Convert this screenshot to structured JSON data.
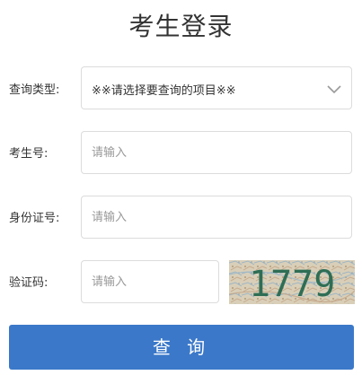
{
  "page": {
    "title": "考生登录"
  },
  "form": {
    "query_type": {
      "label": "查询类型:",
      "value": "※※请选择要查询的项目※※"
    },
    "exam_number": {
      "label": "考生号:",
      "placeholder": "请输入"
    },
    "id_number": {
      "label": "身份证号:",
      "placeholder": "请输入"
    },
    "captcha": {
      "label": "验证码:",
      "placeholder": "请输入",
      "image_text": "1779"
    },
    "submit_label": "查 询"
  },
  "colors": {
    "primary": "#3b78c9",
    "border": "#dcdcdc",
    "captcha_text": "#2e6e55"
  }
}
